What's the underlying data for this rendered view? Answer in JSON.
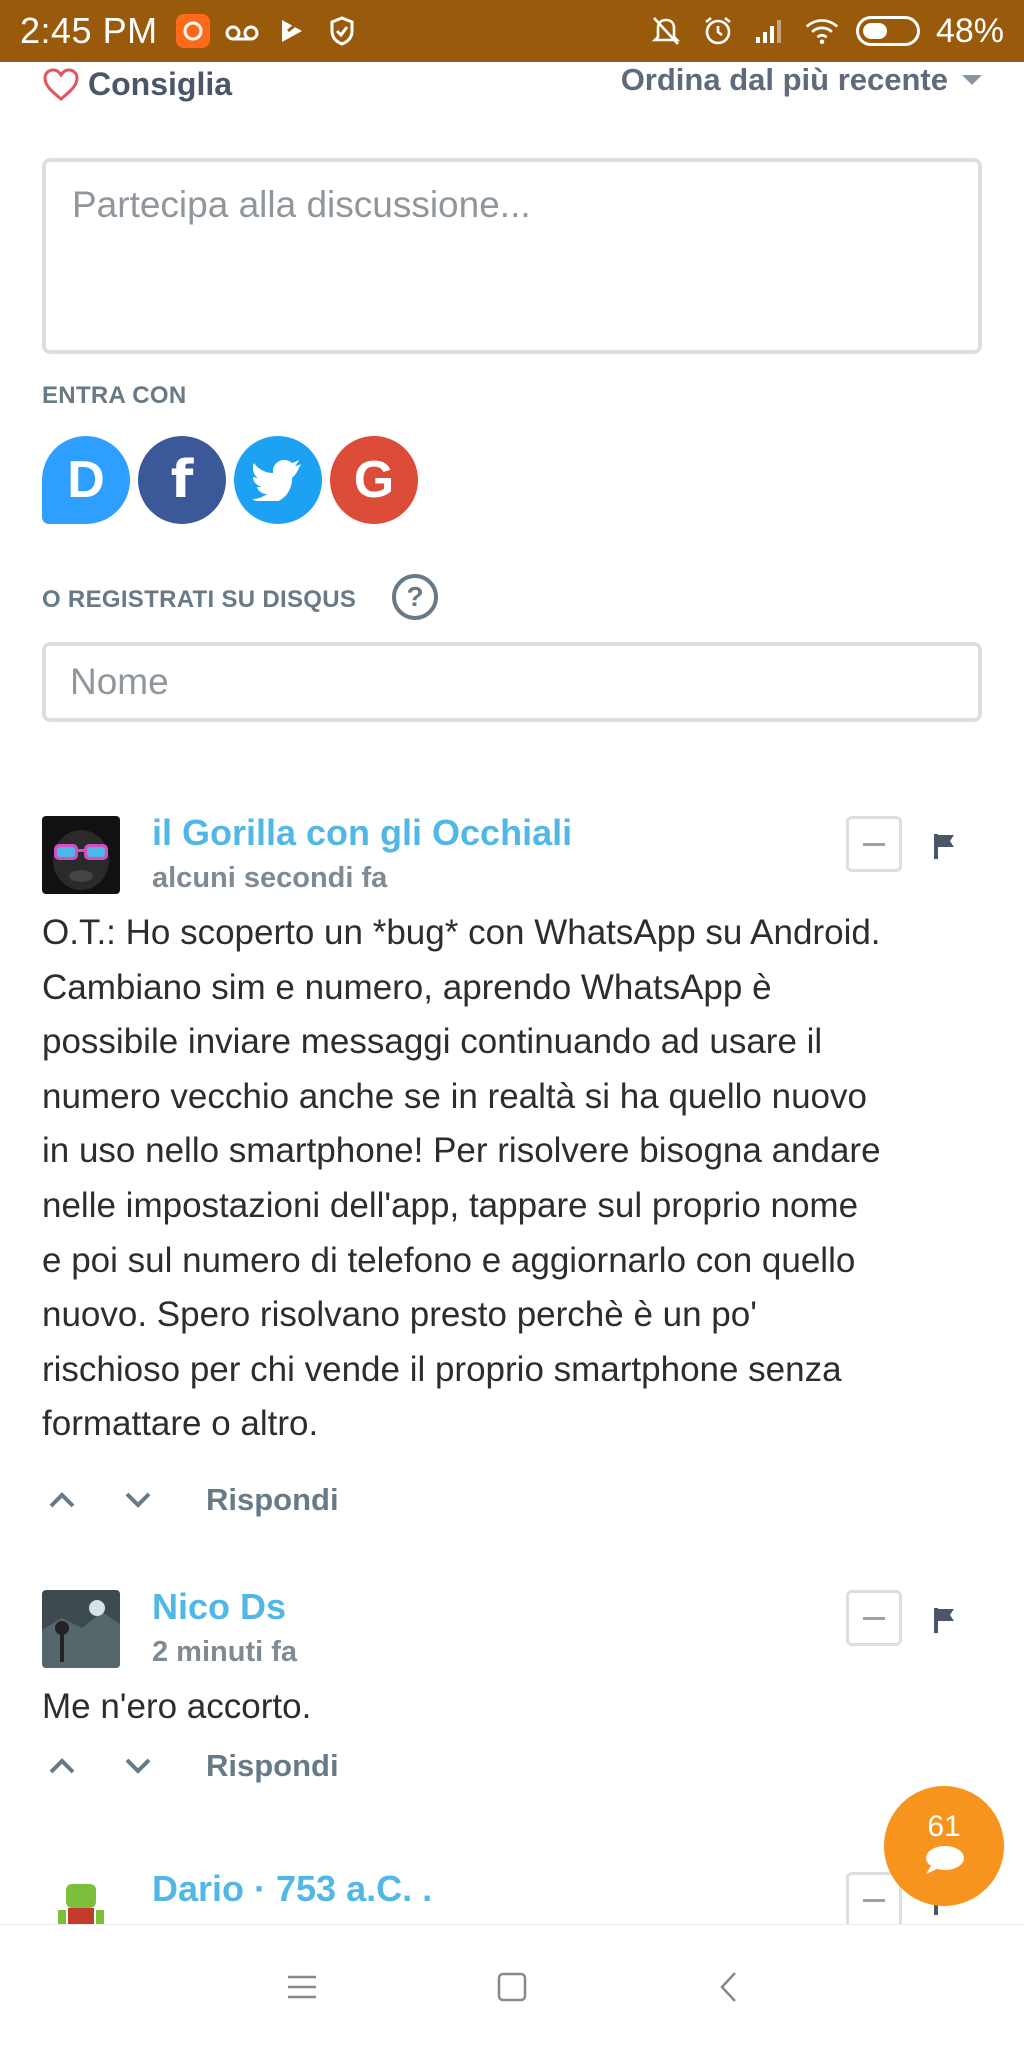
{
  "status_bar": {
    "time": "2:45 PM",
    "battery_percent": "48%",
    "battery_level": 0.48,
    "left_icons": [
      "app-notification-icon",
      "voicemail-icon",
      "play-store-icon",
      "shield-icon"
    ],
    "right_icons": [
      "mute-bell-icon",
      "alarm-icon",
      "signal-icon",
      "wifi-icon",
      "battery-icon"
    ]
  },
  "toolbar": {
    "recommend_label": "Consiglia",
    "sort_label": "Ordina dal più recente"
  },
  "compose": {
    "placeholder": "Partecipa alla discussione...",
    "login_label": "ENTRA CON",
    "social_buttons": [
      {
        "name": "Disqus",
        "glyph": "D",
        "color": "#2e9fff"
      },
      {
        "name": "Facebook",
        "glyph": "f",
        "color": "#3b5998"
      },
      {
        "name": "Twitter",
        "glyph": "bird",
        "color": "#1da1f2"
      },
      {
        "name": "Google",
        "glyph": "G",
        "color": "#dd4b39"
      }
    ],
    "register_label": "O REGISTRATI SU DISQUS",
    "help_glyph": "?",
    "name_placeholder": "Nome"
  },
  "comments": [
    {
      "author": "il Gorilla con gli Occhiali",
      "time": "alcuni secondi fa",
      "lines": [
        "O.T.: Ho scoperto un *bug* con WhatsApp su Android.",
        "Cambiano sim e numero, aprendo WhatsApp è",
        "possibile inviare messaggi continuando ad usare il",
        "numero vecchio anche se in realtà si ha quello nuovo",
        "in uso nello smartphone! Per risolvere bisogna andare",
        "nelle impostazioni dell'app, tappare sul proprio nome",
        "e poi sul numero di telefono e aggiornarlo con quello",
        "nuovo. Spero risolvano presto perchè è un po'",
        "rischioso per chi vende il proprio smartphone senza",
        "formattare o altro."
      ],
      "reply_label": "Rispondi"
    },
    {
      "author": "Nico Ds",
      "time": "2 minuti fa",
      "lines": [
        "Me n'ero accorto."
      ],
      "reply_label": "Rispondi"
    },
    {
      "author": "Dario · 753 a.C. .",
      "time": "",
      "lines": [],
      "reply_label": ""
    }
  ],
  "floating_badge": {
    "count": "61"
  },
  "colors": {
    "status_bar": "#9a5a0c",
    "author_link": "#50b7e6",
    "badge": "#f7941d"
  }
}
